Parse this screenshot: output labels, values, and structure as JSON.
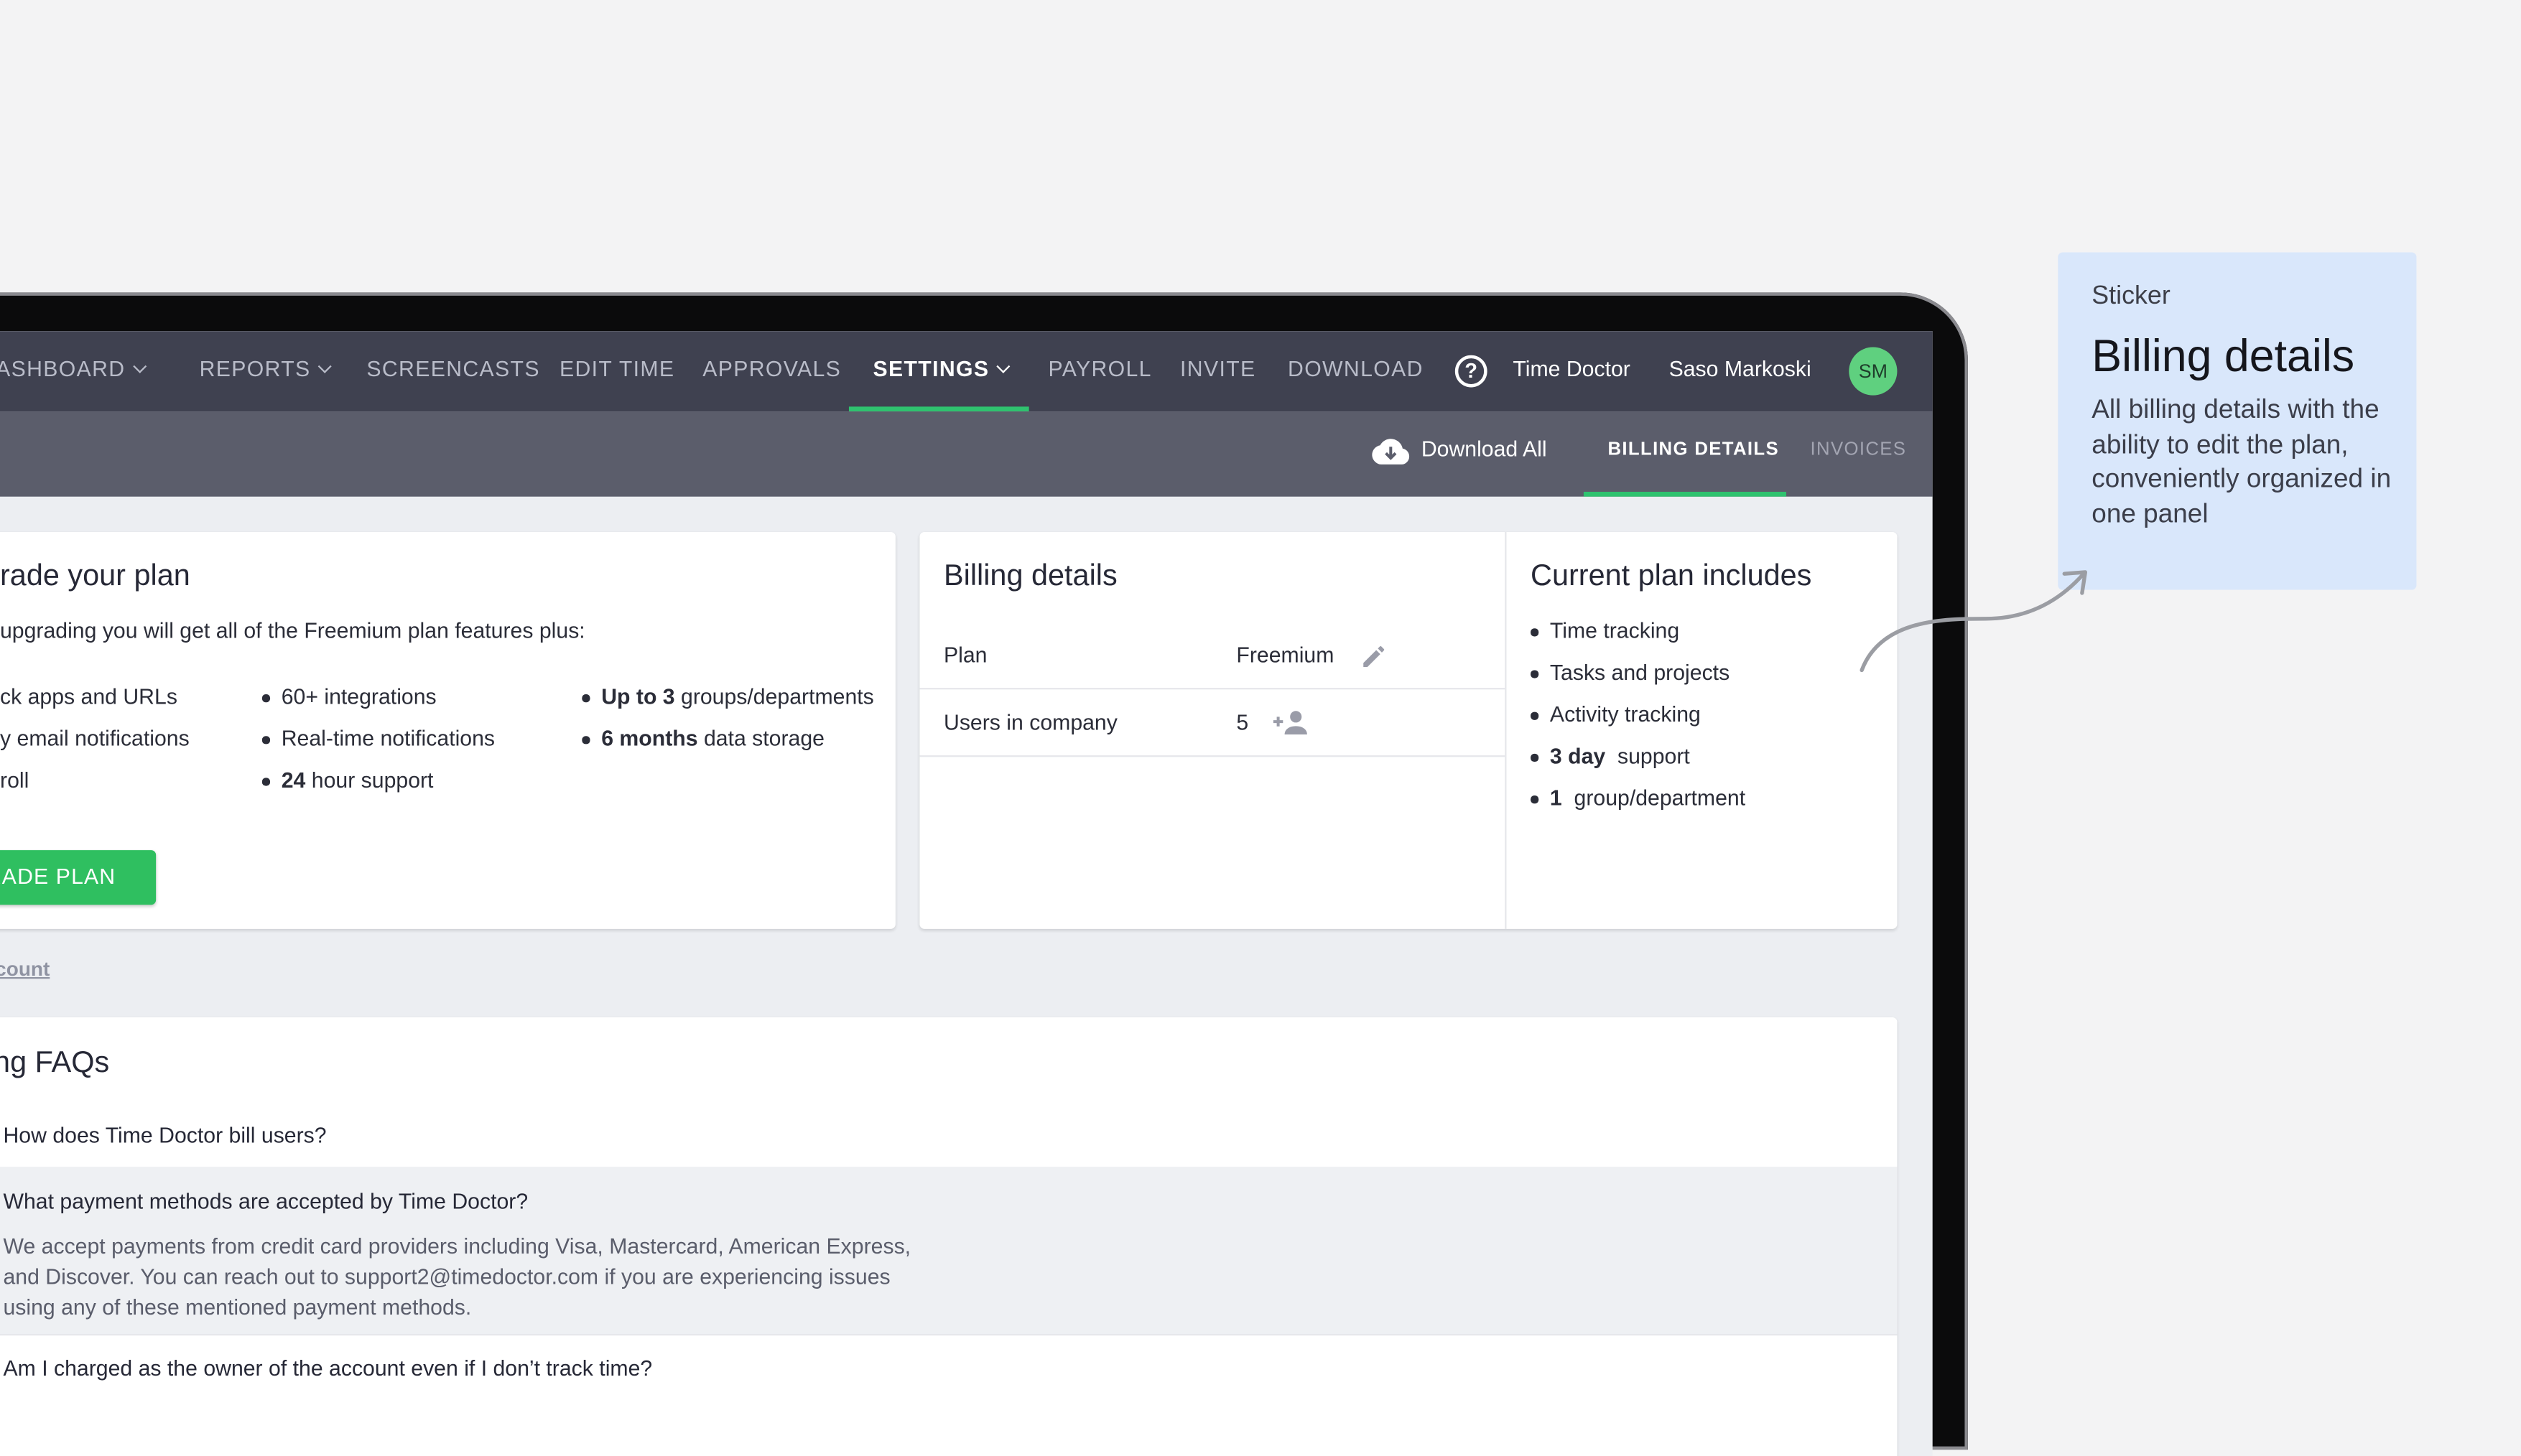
{
  "top_nav": {
    "items": [
      {
        "label": "DASHBOARD",
        "dropdown": true
      },
      {
        "label": "REPORTS",
        "dropdown": true
      },
      {
        "label": "SCREENCASTS",
        "dropdown": false
      },
      {
        "label": "EDIT TIME",
        "dropdown": false
      },
      {
        "label": "APPROVALS",
        "dropdown": false
      },
      {
        "label": "SETTINGS",
        "dropdown": true,
        "active": true
      },
      {
        "label": "PAYROLL",
        "dropdown": false
      },
      {
        "label": "INVITE",
        "dropdown": false
      },
      {
        "label": "DOWNLOAD",
        "dropdown": false
      }
    ],
    "help_icon": "question-circle-icon",
    "help_glyph": "?",
    "company": "Time Doctor",
    "user_name": "Saso Markoski",
    "avatar_initials": "SM"
  },
  "sub_nav": {
    "download_all": "Download All",
    "download_icon": "cloud-download-icon",
    "tabs": [
      {
        "label": "BILLING DETAILS",
        "active": true
      },
      {
        "label": "INVOICES",
        "active": false
      }
    ]
  },
  "upgrade": {
    "title": "rade your plan",
    "intro": "upgrading you will get all of the Freemium plan features plus:",
    "col1": [
      "ck apps and URLs",
      "y email notifications",
      "roll"
    ],
    "col2": [
      {
        "bold": "",
        "text": "60+ integrations"
      },
      {
        "bold": "",
        "text": "Real-time notifications"
      },
      {
        "bold": "24",
        "text": " hour support"
      }
    ],
    "col3": [
      {
        "bold": "Up to 3",
        "text": " groups/departments"
      },
      {
        "bold": "6 months",
        "text": " data storage"
      }
    ],
    "button": "GRADE PLAN",
    "cancel_link": "ccount"
  },
  "billing": {
    "title": "Billing details",
    "rows": [
      {
        "label": "Plan",
        "value": "Freemium",
        "icon": "pencil-icon"
      },
      {
        "label": "Users in company",
        "value": "5",
        "icon": "add-user-icon"
      }
    ]
  },
  "current_plan": {
    "title": "Current plan includes",
    "items": [
      {
        "bold": "",
        "text": "Time tracking"
      },
      {
        "bold": "",
        "text": "Tasks and projects"
      },
      {
        "bold": "",
        "text": "Activity tracking"
      },
      {
        "bold": "3 day",
        "text": "  support"
      },
      {
        "bold": "1",
        "text": "  group/department"
      }
    ]
  },
  "faq": {
    "title": "ng FAQs",
    "q1": "How does Time Doctor bill users?",
    "q2": "What payment methods are accepted by Time Doctor?",
    "a2": [
      "We accept payments from credit card providers including Visa, Mastercard, American Express,",
      "and Discover. You can reach out to support2@timedoctor.com if you are experiencing issues",
      "using any of these mentioned payment methods."
    ],
    "q3": "Am I charged as the owner of the account even if I don’t track time?"
  },
  "sticker": {
    "kicker": "Sticker",
    "title": "Billing details",
    "body": "All billing details with the ability to edit the plan, conveniently organized in one panel",
    "background": "#d9e7fb"
  },
  "colors": {
    "accent_green": "#2fc26f",
    "nav_bg": "#3f4150",
    "subnav_bg": "#5b5d6b"
  }
}
